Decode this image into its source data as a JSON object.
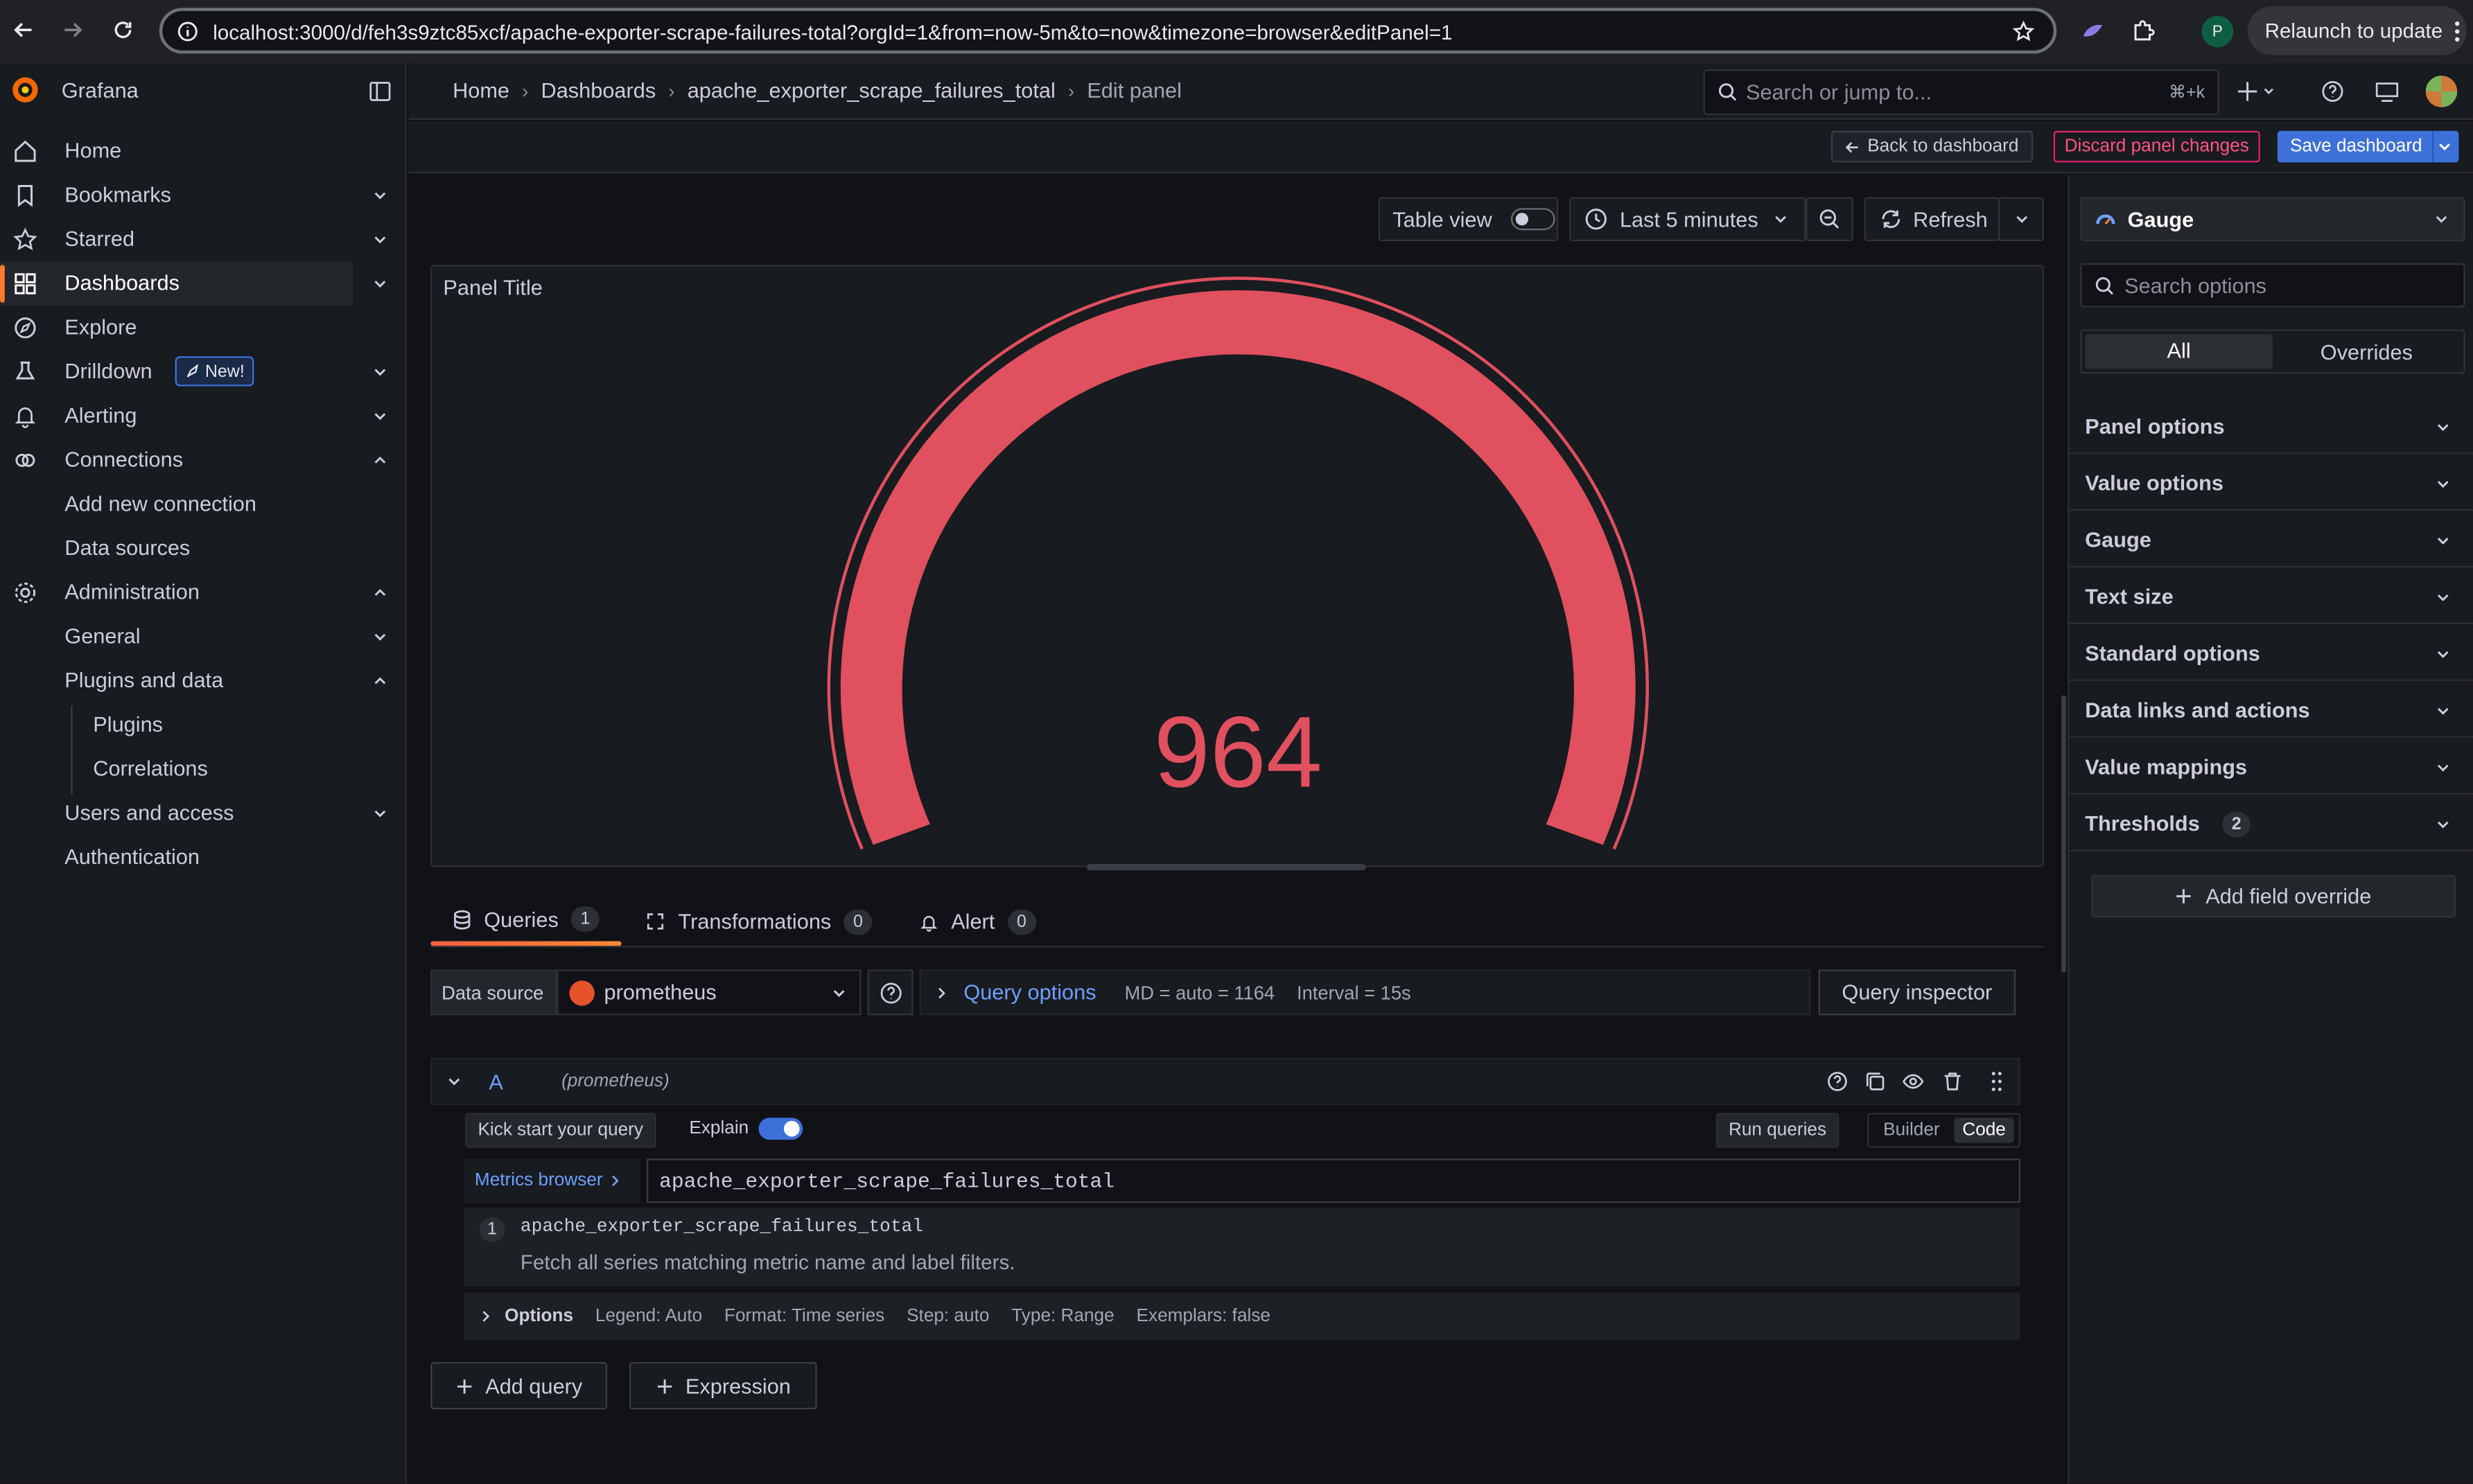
{
  "browser": {
    "url": "localhost:3000/d/feh3s9ztc85xcf/apache-exporter-scrape-failures-total?orgId=1&from=now-5m&to=now&timezone=browser&editPanel=1",
    "profile_initial": "P",
    "relaunch_label": "Relaunch to update"
  },
  "app": {
    "name": "Grafana"
  },
  "sidebar": {
    "items": [
      {
        "label": "Home"
      },
      {
        "label": "Bookmarks"
      },
      {
        "label": "Starred"
      },
      {
        "label": "Dashboards"
      },
      {
        "label": "Explore"
      },
      {
        "label": "Drilldown",
        "badge": "New!"
      },
      {
        "label": "Alerting"
      },
      {
        "label": "Connections"
      },
      {
        "label": "Add new connection"
      },
      {
        "label": "Data sources"
      },
      {
        "label": "Administration"
      },
      {
        "label": "General"
      },
      {
        "label": "Plugins and data"
      },
      {
        "label": "Plugins"
      },
      {
        "label": "Correlations"
      },
      {
        "label": "Users and access"
      },
      {
        "label": "Authentication"
      }
    ]
  },
  "breadcrumb": [
    "Home",
    "Dashboards",
    "apache_exporter_scrape_failures_total",
    "Edit panel"
  ],
  "search": {
    "placeholder": "Search or jump to...",
    "shortcut": "⌘+k"
  },
  "toolbar": {
    "back_label": "Back to dashboard",
    "discard_label": "Discard panel changes",
    "save_label": "Save dashboard"
  },
  "panel_controls": {
    "table_view_label": "Table view",
    "table_view_on": false,
    "time_range": "Last 5 minutes",
    "refresh_label": "Refresh"
  },
  "panel": {
    "title": "Panel Title",
    "gauge_value": "964",
    "gauge_color": "#e0505f"
  },
  "tabs": [
    {
      "label": "Queries",
      "count": "1"
    },
    {
      "label": "Transformations",
      "count": "0"
    },
    {
      "label": "Alert",
      "count": "0"
    }
  ],
  "datasource": {
    "label": "Data source",
    "value": "prometheus",
    "query_options_label": "Query options",
    "md_info": "MD = auto = 1164",
    "interval_info": "Interval = 15s",
    "inspector_label": "Query inspector"
  },
  "query": {
    "ref_id": "A",
    "ds_note": "(prometheus)",
    "kickstart_label": "Kick start your query",
    "explain_label": "Explain",
    "explain_on": true,
    "run_label": "Run queries",
    "builder_label": "Builder",
    "code_label": "Code",
    "metrics_browser_label": "Metrics browser",
    "expression": "apache_exporter_scrape_failures_total",
    "suggestion": {
      "index": "1",
      "metric": "apache_exporter_scrape_failures_total",
      "description": "Fetch all series matching metric name and label filters."
    },
    "options": {
      "label": "Options",
      "legend": "Legend: Auto",
      "format": "Format: Time series",
      "step": "Step: auto",
      "type": "Type: Range",
      "exemplars": "Exemplars: false"
    }
  },
  "bottom_buttons": {
    "add_query": "Add query",
    "expression": "Expression"
  },
  "options_pane": {
    "viz_type": "Gauge",
    "search_placeholder": "Search options",
    "tab_all": "All",
    "tab_overrides": "Overrides",
    "sections": [
      {
        "label": "Panel options"
      },
      {
        "label": "Value options"
      },
      {
        "label": "Gauge"
      },
      {
        "label": "Text size"
      },
      {
        "label": "Standard options"
      },
      {
        "label": "Data links and actions"
      },
      {
        "label": "Value mappings"
      },
      {
        "label": "Thresholds",
        "count": "2"
      }
    ],
    "add_override_label": "Add field override"
  },
  "colors": {
    "accent_blue": "#3d71d9",
    "link_blue": "#6e9fff",
    "brand_orange": "#ff7a2d",
    "danger": "#e0226e"
  }
}
